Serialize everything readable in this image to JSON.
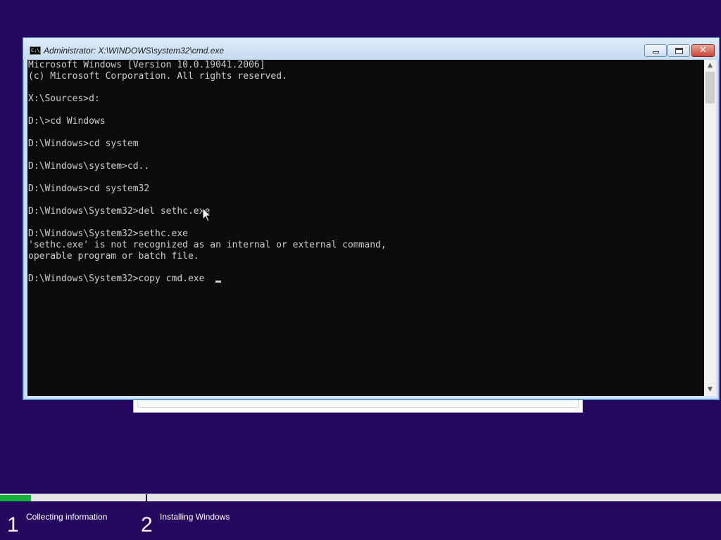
{
  "window": {
    "title": "Administrator: X:\\WINDOWS\\system32\\cmd.exe",
    "icon_text": "C:\\"
  },
  "console": {
    "lines": [
      "Microsoft Windows [Version 10.0.19041.2006]",
      "(c) Microsoft Corporation. All rights reserved.",
      "",
      "X:\\Sources>d:",
      "",
      "D:\\>cd Windows",
      "",
      "D:\\Windows>cd system",
      "",
      "D:\\Windows\\system>cd..",
      "",
      "D:\\Windows>cd system32",
      "",
      "D:\\Windows\\System32>del sethc.exe",
      "",
      "D:\\Windows\\System32>sethc.exe",
      "'sethc.exe' is not recognized as an internal or external command,",
      "operable program or batch file.",
      "",
      "D:\\Windows\\System32>copy cmd.exe "
    ]
  },
  "setup": {
    "progress_fraction": 0.043,
    "steps": [
      {
        "number": "1",
        "label": "Collecting information"
      },
      {
        "number": "2",
        "label": "Installing Windows"
      }
    ],
    "colors": {
      "background": "#24085e",
      "progress": "#16b33a"
    }
  }
}
